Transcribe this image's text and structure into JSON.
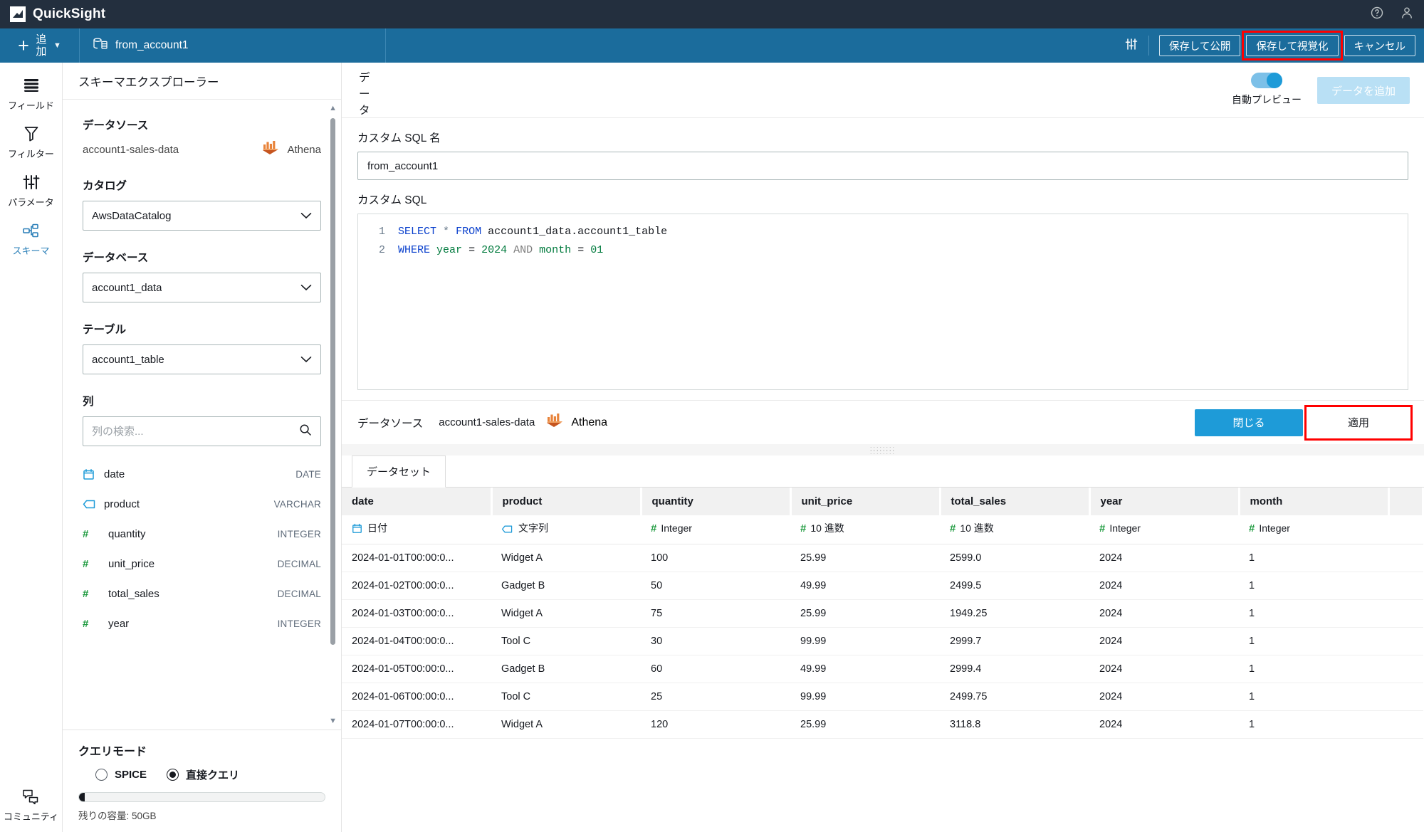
{
  "app": {
    "name": "QuickSight",
    "logo_icon": "quicksight-logo-icon",
    "help_icon": "help-circle-icon",
    "account_icon": "user-account-icon"
  },
  "toolbar": {
    "add_label": "追加",
    "add_icon": "plus-icon",
    "add_chevron_icon": "chevron-down-icon",
    "dataset_tab_label": "from_account1",
    "dataset_tab_icon": "database-icon",
    "settings_icon": "sliders-icon",
    "save_publish_label": "保存して公開",
    "save_visualize_label": "保存して視覚化",
    "cancel_label": "キャンセル",
    "highlight_color": "#ff0000"
  },
  "rail": {
    "items": [
      {
        "label": "フィールド",
        "icon": "fields-icon",
        "active": false
      },
      {
        "label": "フィルター",
        "icon": "filter-icon",
        "active": false
      },
      {
        "label": "パラメータ",
        "icon": "parameters-icon",
        "active": false
      },
      {
        "label": "スキーマ",
        "icon": "schema-icon",
        "active": true
      }
    ],
    "bottom": {
      "label": "コミュニティ",
      "icon": "community-chat-icon"
    }
  },
  "schema": {
    "title": "スキーマエクスプローラー",
    "datasource_label": "データソース",
    "datasource_name": "account1-sales-data",
    "engine_name": "Athena",
    "engine_icon": "athena-icon",
    "catalog_label": "カタログ",
    "catalog_value": "AwsDataCatalog",
    "database_label": "データベース",
    "database_value": "account1_data",
    "table_label": "テーブル",
    "table_value": "account1_table",
    "columns_label": "列",
    "column_search_placeholder": "列の検索...",
    "column_search_value": "",
    "search_icon": "search-icon",
    "columns": [
      {
        "name": "date",
        "type": "DATE",
        "icon": "calendar-icon"
      },
      {
        "name": "product",
        "type": "VARCHAR",
        "icon": "string-tag-icon"
      },
      {
        "name": "quantity",
        "type": "INTEGER",
        "icon": "hash-icon"
      },
      {
        "name": "unit_price",
        "type": "DECIMAL",
        "icon": "hash-icon"
      },
      {
        "name": "total_sales",
        "type": "DECIMAL",
        "icon": "hash-icon"
      },
      {
        "name": "year",
        "type": "INTEGER",
        "icon": "hash-icon"
      }
    ]
  },
  "query_mode": {
    "title": "クエリモード",
    "options": [
      {
        "label": "SPICE",
        "selected": false
      },
      {
        "label": "直接クエリ",
        "selected": true
      }
    ],
    "capacity_text": "残りの容量: 50GB",
    "capacity_percent": 2
  },
  "main": {
    "data_word": "データ",
    "auto_preview_label": "自動プレビュー",
    "auto_preview_on": true,
    "add_data_label": "データを追加",
    "custom_sql_name_label": "カスタム SQL 名",
    "custom_sql_name_value": "from_account1",
    "custom_sql_label": "カスタム SQL",
    "sql_lines": [
      {
        "num": "1",
        "tokens": [
          {
            "t": "SELECT",
            "c": "kw"
          },
          {
            "t": " ",
            "c": "id"
          },
          {
            "t": "*",
            "c": "star"
          },
          {
            "t": " ",
            "c": "id"
          },
          {
            "t": "FROM",
            "c": "kw"
          },
          {
            "t": " account1_data.account1_table",
            "c": "id"
          }
        ]
      },
      {
        "num": "2",
        "tokens": [
          {
            "t": "WHERE",
            "c": "kw"
          },
          {
            "t": " ",
            "c": "id"
          },
          {
            "t": "year",
            "c": "num"
          },
          {
            "t": " = ",
            "c": "id"
          },
          {
            "t": "2024",
            "c": "num"
          },
          {
            "t": " ",
            "c": "id"
          },
          {
            "t": "AND",
            "c": "kw2"
          },
          {
            "t": " ",
            "c": "id"
          },
          {
            "t": "month",
            "c": "num"
          },
          {
            "t": " = ",
            "c": "id"
          },
          {
            "t": "01",
            "c": "num"
          }
        ]
      }
    ],
    "footer": {
      "datasource_label": "データソース",
      "datasource_name": "account1-sales-data",
      "engine_name": "Athena",
      "engine_icon": "athena-icon",
      "close_label": "閉じる",
      "apply_label": "適用"
    }
  },
  "preview": {
    "tab_label": "データセット",
    "grip_icon": "drag-handle-icon",
    "columns": [
      {
        "header": "date",
        "type_label": "日付",
        "type_icon": "calendar-icon"
      },
      {
        "header": "product",
        "type_label": "文字列",
        "type_icon": "string-tag-icon"
      },
      {
        "header": "quantity",
        "type_label": "Integer",
        "type_icon": "hash-icon"
      },
      {
        "header": "unit_price",
        "type_label": "10 進数",
        "type_icon": "hash-icon"
      },
      {
        "header": "total_sales",
        "type_label": "10 進数",
        "type_icon": "hash-icon"
      },
      {
        "header": "year",
        "type_label": "Integer",
        "type_icon": "hash-icon"
      },
      {
        "header": "month",
        "type_label": "Integer",
        "type_icon": "hash-icon"
      }
    ],
    "rows": [
      [
        "2024-01-01T00:00:0...",
        "Widget A",
        "100",
        "25.99",
        "2599.0",
        "2024",
        "1"
      ],
      [
        "2024-01-02T00:00:0...",
        "Gadget B",
        "50",
        "49.99",
        "2499.5",
        "2024",
        "1"
      ],
      [
        "2024-01-03T00:00:0...",
        "Widget A",
        "75",
        "25.99",
        "1949.25",
        "2024",
        "1"
      ],
      [
        "2024-01-04T00:00:0...",
        "Tool C",
        "30",
        "99.99",
        "2999.7",
        "2024",
        "1"
      ],
      [
        "2024-01-05T00:00:0...",
        "Gadget B",
        "60",
        "49.99",
        "2999.4",
        "2024",
        "1"
      ],
      [
        "2024-01-06T00:00:0...",
        "Tool C",
        "25",
        "99.99",
        "2499.75",
        "2024",
        "1"
      ],
      [
        "2024-01-07T00:00:0...",
        "Widget A",
        "120",
        "25.99",
        "3118.8",
        "2024",
        "1"
      ]
    ]
  },
  "colors": {
    "topbar": "#232f3e",
    "toolbar": "#1b6c9c",
    "accent": "#1e9bd8",
    "highlight": "#ff0000",
    "number_icon": "#1d9a3e",
    "date_icon": "#1e9bd8"
  }
}
